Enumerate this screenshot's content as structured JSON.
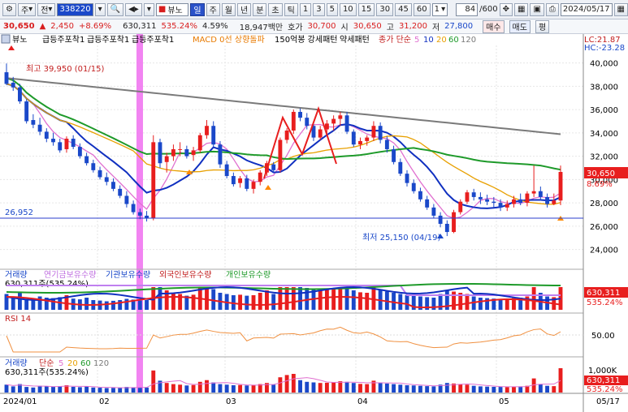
{
  "toolbar": {
    "type_label": "주",
    "prev_label": "전",
    "code": "338220",
    "stock_name": "뷰노",
    "periods": [
      "일",
      "주",
      "월",
      "년",
      "분",
      "초",
      "틱"
    ],
    "active_period": "일",
    "minutes": [
      "1",
      "3",
      "5",
      "10",
      "15",
      "30",
      "45",
      "60"
    ],
    "minute_select": "1",
    "count": "84",
    "count_total": "/600",
    "date": "2024/05/17"
  },
  "quote": {
    "price": "30,650",
    "change_sign": "▲",
    "change": "2,450",
    "change_pct": "+8.69%",
    "volume": "630,311",
    "volume_ratio": "535.24%",
    "turnover": "4.59%",
    "amount": "18,947백만",
    "bid_label": "호가",
    "bid": "30,700",
    "ask_label": "시",
    "ask": "30,650",
    "high_label": "고",
    "high": "31,200",
    "low_label": "저",
    "low": "27,800",
    "buy_label": "매수",
    "sell_label": "매도",
    "eval_label": "평"
  },
  "legend": {
    "name": "뷰노",
    "items": [
      "급등주포착1",
      "급등주포착1",
      "급등주포착1",
      "MACD 0선 상향돌파",
      "150억봉 강세패턴",
      "약세패턴"
    ],
    "ma_label": "종가 단순",
    "ma_periods": [
      "5",
      "10",
      "20",
      "60",
      "120"
    ],
    "lc": "LC:21.87",
    "hc": "HC:-23.28"
  },
  "annotations": {
    "high": "최고 39,950 (01/15)",
    "low": "최저 25,150 (04/19)",
    "hline": "26,952"
  },
  "price_axis": {
    "ticks": [
      "40,000",
      "38,000",
      "36,000",
      "34,000",
      "32,000",
      "30,000",
      "28,000",
      "26,000",
      "24,000"
    ],
    "last": "30,650",
    "last_pct": "8.69%"
  },
  "investor_panel": {
    "labels": [
      "거래량",
      "연기금보유수량",
      "기관보유수량",
      "외국인보유수량",
      "개인보유수량"
    ],
    "subtitle": "630,311주(535.24%)",
    "axis_last": "630,311",
    "axis_pct": "535.24%"
  },
  "rsi_panel": {
    "label": "RSI 14",
    "tick": "50.00"
  },
  "volume_panel": {
    "label": "거래량",
    "ma_label": "단순",
    "ma_periods": [
      "5",
      "20",
      "60",
      "120"
    ],
    "subtitle": "630,311주(535.24%)",
    "tick": "1,000K",
    "axis_last": "630,311",
    "axis_pct": "535.24%"
  },
  "date_axis": [
    "2024/01",
    "02",
    "03",
    "04",
    "05"
  ],
  "date_axis_end": "05/17",
  "colors": {
    "up": "#e81e1e",
    "down": "#1a48c9",
    "ma5": "#e070d0",
    "ma10": "#1030c0",
    "ma20": "#e8a000",
    "ma60": "#1e9a2a",
    "ma120": "#7a7a7a",
    "highlight": "#f06ef0"
  },
  "chart_data": {
    "type": "candlestick",
    "candles": [
      [
        39200,
        39950,
        38100,
        38200
      ],
      [
        38300,
        38800,
        37600,
        37900
      ],
      [
        37900,
        38200,
        36500,
        36700
      ],
      [
        36700,
        36900,
        34800,
        35000
      ],
      [
        35100,
        35600,
        34400,
        34700
      ],
      [
        34700,
        35300,
        33800,
        34100
      ],
      [
        34100,
        34400,
        33200,
        33500
      ],
      [
        33500,
        34000,
        32900,
        33200
      ],
      [
        33200,
        33500,
        32300,
        32500
      ],
      [
        32600,
        33700,
        32300,
        33500
      ],
      [
        33500,
        33800,
        32600,
        32800
      ],
      [
        32800,
        33100,
        31800,
        32000
      ],
      [
        32000,
        32300,
        31200,
        31400
      ],
      [
        31400,
        31700,
        30600,
        30800
      ],
      [
        30800,
        31100,
        30000,
        30200
      ],
      [
        30200,
        30600,
        29500,
        29800
      ],
      [
        29800,
        30100,
        29000,
        29200
      ],
      [
        29200,
        29500,
        28400,
        28600
      ],
      [
        28600,
        29000,
        27600,
        27900
      ],
      [
        27900,
        28200,
        27000,
        27200
      ],
      [
        27200,
        27500,
        26600,
        26900
      ],
      [
        26900,
        27300,
        26400,
        26700
      ],
      [
        26700,
        33800,
        26500,
        33200
      ],
      [
        33200,
        33500,
        31000,
        31400
      ],
      [
        31500,
        32300,
        30600,
        32000
      ],
      [
        32000,
        33000,
        31600,
        32600
      ],
      [
        32600,
        33200,
        32000,
        32600
      ],
      [
        32600,
        32900,
        31800,
        32000
      ],
      [
        32100,
        32800,
        31600,
        32500
      ],
      [
        32500,
        34000,
        32300,
        33800
      ],
      [
        33800,
        35100,
        33500,
        34600
      ],
      [
        34600,
        35000,
        32800,
        33000
      ],
      [
        33000,
        33300,
        31000,
        31300
      ],
      [
        31300,
        31600,
        30100,
        30300
      ],
      [
        30300,
        30600,
        29400,
        29600
      ],
      [
        29700,
        30300,
        29300,
        30100
      ],
      [
        30100,
        30400,
        29000,
        29200
      ],
      [
        29200,
        30000,
        28800,
        29800
      ],
      [
        29800,
        30800,
        29500,
        30600
      ],
      [
        30600,
        31600,
        30300,
        31400
      ],
      [
        31300,
        31500,
        30600,
        30800
      ],
      [
        30800,
        33600,
        30600,
        33400
      ],
      [
        33400,
        34400,
        33100,
        34200
      ],
      [
        34200,
        36000,
        33900,
        35800
      ],
      [
        35800,
        36100,
        35000,
        35300
      ],
      [
        35300,
        35700,
        34300,
        34600
      ],
      [
        34600,
        35000,
        33300,
        33600
      ],
      [
        33600,
        34600,
        33400,
        34300
      ],
      [
        34300,
        35100,
        33900,
        34800
      ],
      [
        34800,
        35500,
        34200,
        35200
      ],
      [
        35200,
        35800,
        34600,
        35500
      ],
      [
        35500,
        35800,
        33900,
        34100
      ],
      [
        34100,
        34300,
        32800,
        33000
      ],
      [
        33000,
        33600,
        32600,
        33300
      ],
      [
        33300,
        33800,
        32900,
        33600
      ],
      [
        33600,
        35000,
        33300,
        34600
      ],
      [
        34600,
        34900,
        33100,
        33400
      ],
      [
        33400,
        33700,
        32300,
        32600
      ],
      [
        32600,
        32900,
        31300,
        31500
      ],
      [
        31500,
        31800,
        30300,
        30500
      ],
      [
        30500,
        30800,
        29400,
        29700
      ],
      [
        29700,
        30000,
        28800,
        29000
      ],
      [
        29000,
        29300,
        28100,
        28300
      ],
      [
        28300,
        28600,
        27400,
        27600
      ],
      [
        27600,
        27900,
        26700,
        26900
      ],
      [
        26900,
        27200,
        25900,
        26200
      ],
      [
        26200,
        26500,
        25150,
        25500
      ],
      [
        25500,
        27400,
        25400,
        27200
      ],
      [
        27200,
        28300,
        27000,
        28100
      ],
      [
        28100,
        29100,
        27900,
        28900
      ],
      [
        28900,
        29200,
        28200,
        28500
      ],
      [
        28500,
        28900,
        27900,
        28300
      ],
      [
        28300,
        28700,
        27800,
        28100
      ],
      [
        28100,
        28500,
        27600,
        28000
      ],
      [
        28000,
        28300,
        27300,
        27600
      ],
      [
        27600,
        28200,
        27300,
        27900
      ],
      [
        27900,
        28600,
        27600,
        28300
      ],
      [
        28300,
        28800,
        27800,
        28000
      ],
      [
        28000,
        29000,
        27700,
        28800
      ],
      [
        28800,
        31200,
        28500,
        29000
      ],
      [
        29000,
        29400,
        28200,
        28500
      ],
      [
        28500,
        28800,
        27600,
        27900
      ],
      [
        27900,
        28800,
        27800,
        28200
      ],
      [
        28200,
        31200,
        27800,
        30650
      ]
    ],
    "volume": [
      55,
      40,
      60,
      35,
      30,
      45,
      40,
      38,
      42,
      50,
      36,
      33,
      40,
      30,
      28,
      25,
      27,
      30,
      35,
      32,
      28,
      30,
      180,
      90,
      70,
      60,
      55,
      48,
      52,
      80,
      95,
      75,
      60,
      55,
      50,
      52,
      48,
      50,
      60,
      70,
      55,
      120,
      140,
      150,
      95,
      80,
      75,
      70,
      72,
      78,
      85,
      80,
      70,
      62,
      60,
      90,
      75,
      65,
      60,
      55,
      50,
      48,
      45,
      42,
      40,
      55,
      70,
      65,
      60,
      55,
      45,
      40,
      38,
      36,
      35,
      34,
      38,
      40,
      45,
      110,
      60,
      45,
      42,
      200
    ],
    "ylim": [
      23000,
      41500
    ]
  }
}
